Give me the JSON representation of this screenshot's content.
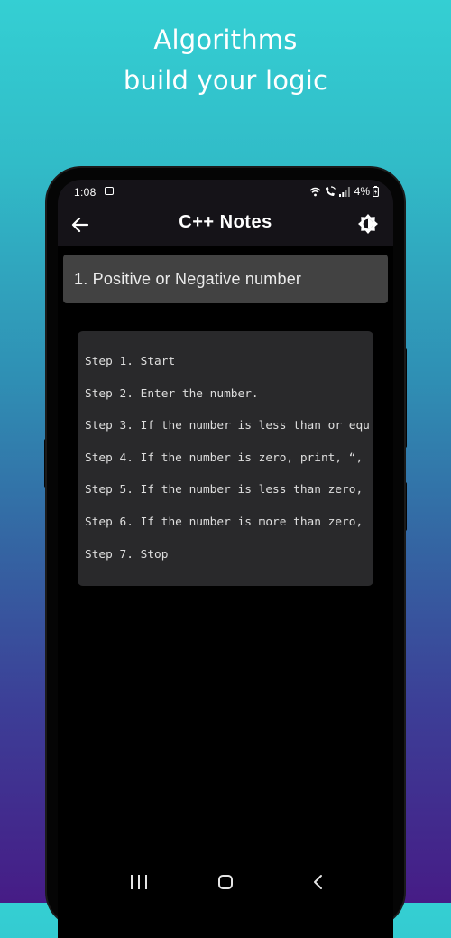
{
  "promo": {
    "line1": "Algorithms",
    "line2": "build your logic"
  },
  "status_bar": {
    "time": "1:08",
    "battery": "4%",
    "icons": [
      "gallery-icon",
      "wifi-icon",
      "wifi-calling-icon",
      "signal-icon",
      "battery-icon"
    ]
  },
  "app_bar": {
    "title": "C++ Notes",
    "back_icon": "arrow-left-icon",
    "theme_icon": "brightness-icon"
  },
  "note": {
    "heading": "1. Positive or Negative number",
    "steps": [
      "Step 1. Start",
      "Step 2. Enter the number.",
      "Step 3. If the number is less than or equ",
      "Step 4. If the number is zero, print, “,",
      "Step 5. If the number is less than zero,",
      "Step 6. If the number is more than zero,",
      "Step 7. Stop"
    ]
  },
  "nav_bar": {
    "icons": [
      "recent-apps-icon",
      "home-icon",
      "back-icon"
    ]
  },
  "colors": {
    "gradient_top": "#34cfd3",
    "gradient_bottom": "#461c86",
    "app_bar_bg": "#151318",
    "heading_bg": "#424242",
    "code_bg": "#29292b",
    "screen_bg": "#000000"
  }
}
